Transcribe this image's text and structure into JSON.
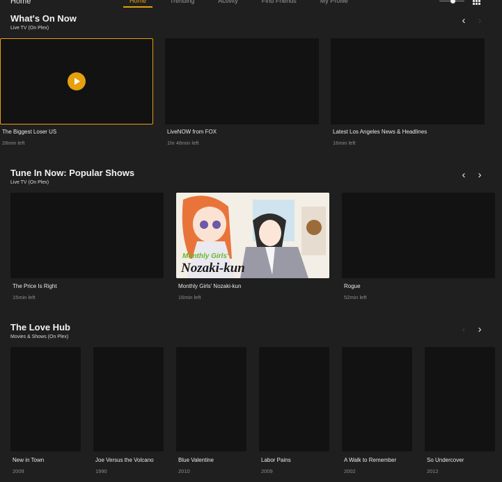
{
  "header": {
    "page_label": "Home",
    "tabs": [
      {
        "label": "Home",
        "active": true
      },
      {
        "label": "Trending",
        "active": false
      },
      {
        "label": "Activity",
        "active": false
      },
      {
        "label": "Find Friends",
        "active": false
      },
      {
        "label": "My Profile",
        "active": false
      }
    ],
    "zoom_slider_level": 0.55,
    "grid_icon": "grid-view-icon"
  },
  "sections": [
    {
      "title": "What's On Now",
      "subtitle": "Live TV (On Plex)",
      "prev_enabled": true,
      "next_enabled": false,
      "items": [
        {
          "title": "The Biggest Loser US",
          "meta": "28min left",
          "selected": true
        },
        {
          "title": "LiveNOW from FOX",
          "meta": "1hr 46min left"
        },
        {
          "title": "Latest Los Angeles News & Headlines",
          "meta": "16min left"
        }
      ]
    },
    {
      "title": "Tune In Now: Popular Shows",
      "subtitle": "Live TV (On Plex)",
      "prev_enabled": true,
      "next_enabled": true,
      "items": [
        {
          "title": "The Price Is Right",
          "meta": "15min left"
        },
        {
          "title": "Monthly Girls' Nozaki-kun",
          "meta": "16min left",
          "poster_small": "Monthly Girls'",
          "poster_big": "Nozaki-kun"
        },
        {
          "title": "Rogue",
          "meta": "52min left"
        }
      ]
    },
    {
      "title": "The Love Hub",
      "subtitle": "Movies & Shows (On Plex)",
      "prev_enabled": false,
      "next_enabled": true,
      "items": [
        {
          "title": "New in Town",
          "meta": "2009"
        },
        {
          "title": "Joe Versus the Volcano",
          "meta": "1990"
        },
        {
          "title": "Blue Valentine",
          "meta": "2010"
        },
        {
          "title": "Labor Pains",
          "meta": "2009"
        },
        {
          "title": "A Walk to Remember",
          "meta": "2002"
        },
        {
          "title": "So Undercover",
          "meta": "2012"
        }
      ]
    }
  ],
  "colors": {
    "accent": "#e5a00d",
    "background": "#1f1f1f",
    "thumbnail": "#121212"
  }
}
